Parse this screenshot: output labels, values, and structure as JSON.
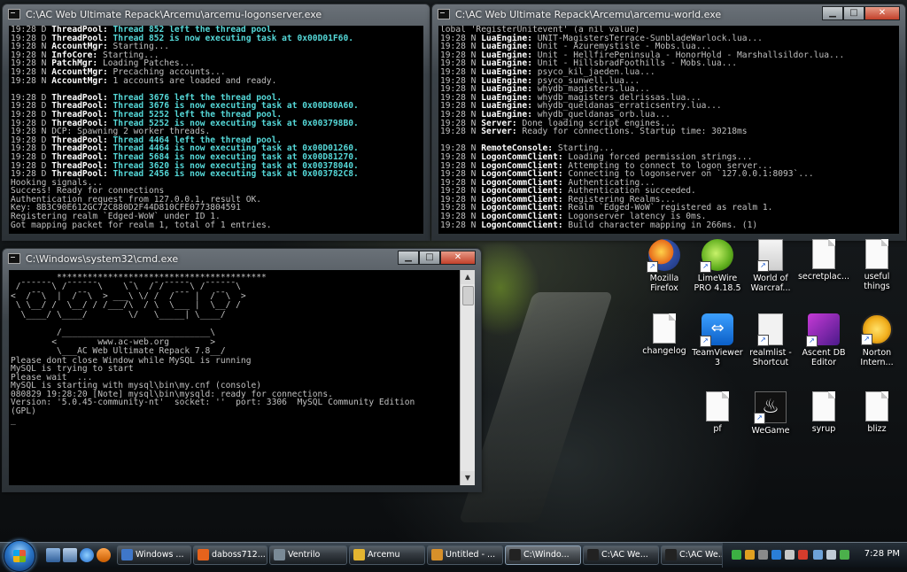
{
  "win_logon": {
    "title": "C:\\AC Web Ultimate Repack\\Arcemu\\arcemu-logonserver.exe",
    "lines": [
      [
        [
          "19:28 D ",
          ""
        ],
        [
          "ThreadPool: ",
          "hl"
        ],
        [
          "Thread 852 left the thread pool.",
          "cy"
        ]
      ],
      [
        [
          "19:28 D ",
          ""
        ],
        [
          "ThreadPool: ",
          "hl"
        ],
        [
          "Thread 852 is now executing task at 0x00D01F60.",
          "cy"
        ]
      ],
      [
        [
          "19:28 N ",
          ""
        ],
        [
          "AccountMgr: ",
          "hl"
        ],
        [
          "Starting...",
          ""
        ]
      ],
      [
        [
          "19:28 N ",
          ""
        ],
        [
          "InfoCore: ",
          "hl"
        ],
        [
          "Starting...",
          ""
        ]
      ],
      [
        [
          "19:28 N ",
          ""
        ],
        [
          "PatchMgr: ",
          "hl"
        ],
        [
          "Loading Patches...",
          ""
        ]
      ],
      [
        [
          "19:28 N ",
          ""
        ],
        [
          "AccountMgr: ",
          "hl"
        ],
        [
          "Precaching accounts...",
          ""
        ]
      ],
      [
        [
          "19:28 N ",
          ""
        ],
        [
          "AccountMgr: ",
          "hl"
        ],
        [
          "1 accounts are loaded and ready.",
          ""
        ]
      ],
      [
        [
          "",
          ""
        ]
      ],
      [
        [
          "19:28 D ",
          ""
        ],
        [
          "ThreadPool: ",
          "hl"
        ],
        [
          "Thread 3676 left the thread pool.",
          "cy"
        ]
      ],
      [
        [
          "19:28 D ",
          ""
        ],
        [
          "ThreadPool: ",
          "hl"
        ],
        [
          "Thread 3676 is now executing task at 0x00D80A60.",
          "cy"
        ]
      ],
      [
        [
          "19:28 D ",
          ""
        ],
        [
          "ThreadPool: ",
          "hl"
        ],
        [
          "Thread 5252 left the thread pool.",
          "cy"
        ]
      ],
      [
        [
          "19:28 D ",
          ""
        ],
        [
          "ThreadPool: ",
          "hl"
        ],
        [
          "Thread 5252 is now executing task at 0x003798B0.",
          "cy"
        ]
      ],
      [
        [
          "19:28 N ",
          ""
        ],
        [
          "DCP: Spawning 2 worker threads.",
          ""
        ]
      ],
      [
        [
          "19:28 D ",
          ""
        ],
        [
          "ThreadPool: ",
          "hl"
        ],
        [
          "Thread 4464 left the thread pool.",
          "cy"
        ]
      ],
      [
        [
          "19:28 D ",
          ""
        ],
        [
          "ThreadPool: ",
          "hl"
        ],
        [
          "Thread 4464 is now executing task at 0x00D01260.",
          "cy"
        ]
      ],
      [
        [
          "19:28 D ",
          ""
        ],
        [
          "ThreadPool: ",
          "hl"
        ],
        [
          "Thread 5684 is now executing task at 0x00D81270.",
          "cy"
        ]
      ],
      [
        [
          "19:28 D ",
          ""
        ],
        [
          "ThreadPool: ",
          "hl"
        ],
        [
          "Thread 3620 is now executing task at 0x00378040.",
          "cy"
        ]
      ],
      [
        [
          "19:28 D ",
          ""
        ],
        [
          "ThreadPool: ",
          "hl"
        ],
        [
          "Thread 2456 is now executing task at 0x003782C8.",
          "cy"
        ]
      ],
      [
        [
          "Hooking signals...",
          ""
        ]
      ],
      [
        [
          "Success! Ready for connections",
          ""
        ]
      ],
      [
        [
          "Authentication request from 127.0.0.1, result OK.",
          ""
        ]
      ],
      [
        [
          "Key: 8B3C90E612GC72C880D2F44D810CFE0773804591",
          ""
        ]
      ],
      [
        [
          "Registering realm `Edged-WoW` under ID 1.",
          ""
        ]
      ],
      [
        [
          "Got mapping packet for realm 1, total of 1 entries.",
          ""
        ]
      ]
    ]
  },
  "win_world": {
    "title": "C:\\AC Web Ultimate Repack\\Arcemu\\arcemu-world.exe",
    "lines": [
      [
        [
          "lobal 'RegisterUnitevent' (a nil value)",
          ""
        ]
      ],
      [
        [
          "19:28 N ",
          ""
        ],
        [
          "LuaEngine: ",
          "hl"
        ],
        [
          "UNIT-MagistersTerrace-SunbladeWarlock.lua...",
          ""
        ]
      ],
      [
        [
          "19:28 N ",
          ""
        ],
        [
          "LuaEngine: ",
          "hl"
        ],
        [
          "Unit - Azuremystisle - Mobs.lua...",
          ""
        ]
      ],
      [
        [
          "19:28 N ",
          ""
        ],
        [
          "LuaEngine: ",
          "hl"
        ],
        [
          "Unit - HellfirePeninsula - HonorHold - Marshallsildor.lua...",
          ""
        ]
      ],
      [
        [
          "19:28 N ",
          ""
        ],
        [
          "LuaEngine: ",
          "hl"
        ],
        [
          "Unit - HillsbradFoothills - Mobs.lua...",
          ""
        ]
      ],
      [
        [
          "19:28 N ",
          ""
        ],
        [
          "LuaEngine: ",
          "hl"
        ],
        [
          "psyco_kil_jaeden.lua...",
          ""
        ]
      ],
      [
        [
          "19:28 N ",
          ""
        ],
        [
          "LuaEngine: ",
          "hl"
        ],
        [
          "psyco_sunwell.lua...",
          ""
        ]
      ],
      [
        [
          "19:28 N ",
          ""
        ],
        [
          "LuaEngine: ",
          "hl"
        ],
        [
          "whydb_magisters.lua...",
          ""
        ]
      ],
      [
        [
          "19:28 N ",
          ""
        ],
        [
          "LuaEngine: ",
          "hl"
        ],
        [
          "whydb_magisters_delrissas.lua...",
          ""
        ]
      ],
      [
        [
          "19:28 N ",
          ""
        ],
        [
          "LuaEngine: ",
          "hl"
        ],
        [
          "whydb_queldanas_erraticsentry.lua...",
          ""
        ]
      ],
      [
        [
          "19:28 N ",
          ""
        ],
        [
          "LuaEngine: ",
          "hl"
        ],
        [
          "whydb_queldanas_orb.lua...",
          ""
        ]
      ],
      [
        [
          "19:28 N ",
          ""
        ],
        [
          "Server: ",
          "hl"
        ],
        [
          "Done loading script engines...",
          ""
        ]
      ],
      [
        [
          "19:28 N ",
          ""
        ],
        [
          "Server: ",
          "hl"
        ],
        [
          "Ready for connections. Startup time: 30218ms",
          ""
        ]
      ],
      [
        [
          "",
          ""
        ]
      ],
      [
        [
          "19:28 N ",
          ""
        ],
        [
          "RemoteConsole: ",
          "hl"
        ],
        [
          "Starting...",
          ""
        ]
      ],
      [
        [
          "19:28 N ",
          ""
        ],
        [
          "LogonCommClient: ",
          "hl"
        ],
        [
          "Loading forced permission strings...",
          ""
        ]
      ],
      [
        [
          "19:28 N ",
          ""
        ],
        [
          "LogonCommClient: ",
          "hl"
        ],
        [
          "Attempting to connect to logon server...",
          ""
        ]
      ],
      [
        [
          "19:28 N ",
          ""
        ],
        [
          "LogonCommClient: ",
          "hl"
        ],
        [
          "Connecting to logonserver on `127.0.0.1:8093`...",
          ""
        ]
      ],
      [
        [
          "19:28 N ",
          ""
        ],
        [
          "LogonCommClient: ",
          "hl"
        ],
        [
          "Authenticating...",
          ""
        ]
      ],
      [
        [
          "19:28 N ",
          ""
        ],
        [
          "LogonCommClient: ",
          "hl"
        ],
        [
          "Authentication succeeded.",
          ""
        ]
      ],
      [
        [
          "19:28 N ",
          ""
        ],
        [
          "LogonCommClient: ",
          "hl"
        ],
        [
          "Registering Realms...",
          ""
        ]
      ],
      [
        [
          "19:28 N ",
          ""
        ],
        [
          "LogonCommClient: ",
          "hl"
        ],
        [
          "Realm `Edged-WoW` registered as realm 1.",
          ""
        ]
      ],
      [
        [
          "19:28 N ",
          ""
        ],
        [
          "LogonCommClient: ",
          "hl"
        ],
        [
          "Logonserver latency is 0ms.",
          ""
        ]
      ],
      [
        [
          "19:28 N ",
          ""
        ],
        [
          "LogonCommClient: ",
          "hl"
        ],
        [
          "Build character mapping in 266ms. (1)",
          ""
        ]
      ]
    ]
  },
  "win_cmd": {
    "title": "C:\\Windows\\system32\\cmd.exe",
    "banner": [
      "         *****************************************",
      " /¯¯¯¯¯¯\\ /¯¯¯¯¯¯\\    \\¯\\  /¯/¯¯¯¯¯\\ /¯¯¯¯¯¯\\",
      "<  /¯¯\\  |  /¯¯\\  > ___\\ \\/ /  /¯¯¯ |  /¯¯\\  >",
      " \\ \\__/ /  \\__/ / /___/\\  / \\  \\___ |  \\__/ /",
      "  \\____/ \\____/        \\/   \\_____| \\____/",
      "",
      "         /_____________________________\\",
      "        <        www.ac-web.org        >",
      "         \\___AC Web Ultimate Repack 7.8__/"
    ],
    "lines": [
      "Please dont close Window while MySQL is running",
      "MySQL is trying to start",
      "Please wait  ...",
      "MySQL is starting with mysql\\bin\\my.cnf (console)",
      "080829 19:28:20 [Note] mysql\\bin\\mysqld: ready for connections.",
      "Version: '5.0.45-community-nt'  socket: ''  port: 3306  MySQL Community Edition",
      "(GPL)",
      "_"
    ]
  },
  "desktop_icons": [
    {
      "name": "firefox-icon",
      "label": "Mozilla Firefox",
      "kind": "ff",
      "shortcut": true
    },
    {
      "name": "limewire-icon",
      "label": "LimeWire PRO 4.18.5",
      "kind": "lw",
      "shortcut": true
    },
    {
      "name": "wow-icon",
      "label": "World of Warcraf...",
      "kind": "wow",
      "shortcut": true
    },
    {
      "name": "secretplace-icon",
      "label": "secretplac...",
      "kind": "doc",
      "shortcut": false
    },
    {
      "name": "useful-things-icon",
      "label": "useful things",
      "kind": "doc",
      "shortcut": false
    },
    {
      "name": "changelog-icon",
      "label": "changelog",
      "kind": "doc",
      "shortcut": false
    },
    {
      "name": "teamviewer-icon",
      "label": "TeamViewer 3",
      "kind": "tv",
      "shortcut": true
    },
    {
      "name": "realmlist-icon",
      "label": "realmlist - Shortcut",
      "kind": "rl",
      "shortcut": true
    },
    {
      "name": "ascent-db-editor-icon",
      "label": "Ascent DB Editor",
      "kind": "ascent",
      "shortcut": true
    },
    {
      "name": "norton-icon",
      "label": "Norton Intern...",
      "kind": "norton",
      "shortcut": true
    },
    {
      "name": "pf-icon",
      "label": "pf",
      "kind": "doc",
      "shortcut": false
    },
    {
      "name": "wegame-icon",
      "label": "WeGame",
      "kind": "wegame",
      "shortcut": true
    },
    {
      "name": "syrup-icon",
      "label": "syrup",
      "kind": "doc",
      "shortcut": false
    },
    {
      "name": "blizz-icon",
      "label": "blizz",
      "kind": "doc",
      "shortcut": false
    }
  ],
  "taskbar": {
    "tasks": [
      {
        "label": "Windows ...",
        "color": "#3f77c9"
      },
      {
        "label": "daboss712...",
        "color": "#e6631c"
      },
      {
        "label": "Ventrilo",
        "color": "#7a8a96"
      },
      {
        "label": "Arcemu",
        "color": "#e4b530"
      },
      {
        "label": "Untitled - ...",
        "color": "#d7902a"
      },
      {
        "label": "C:\\Windo...",
        "color": "#222222"
      },
      {
        "label": "C:\\AC We...",
        "color": "#222222"
      },
      {
        "label": "C:\\AC We...",
        "color": "#222222"
      }
    ],
    "clock": "7:28 PM"
  }
}
